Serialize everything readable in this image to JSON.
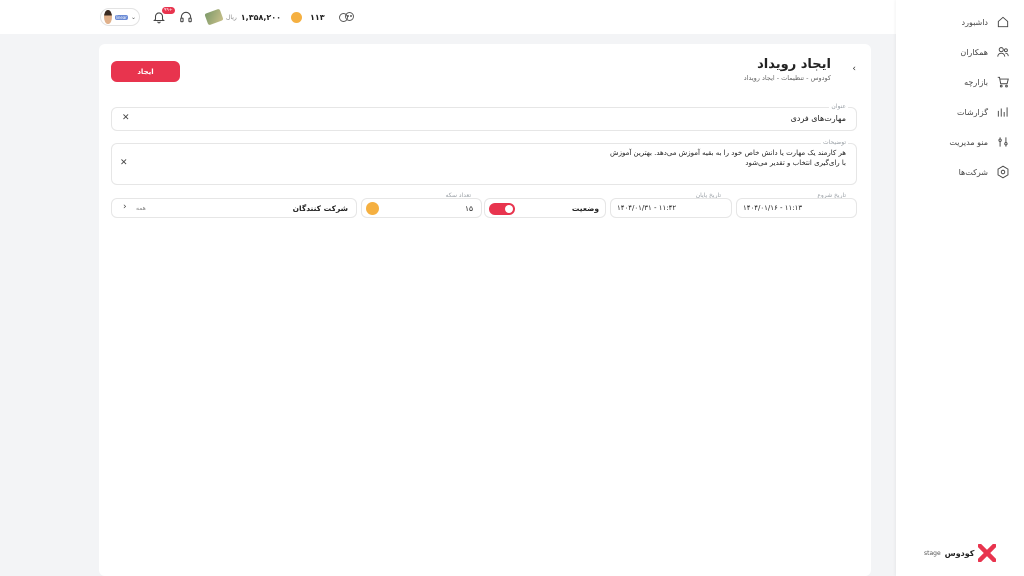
{
  "header": {
    "balance": "۱,۳۵۸,۲۰۰",
    "currency": "ریال",
    "coins": "۱۱۳",
    "notif_count": "۹۹+",
    "avatar_tag": "linear"
  },
  "sidebar": {
    "items": [
      {
        "label": "داشبورد",
        "icon": "home-icon"
      },
      {
        "label": "همکاران",
        "icon": "users-icon"
      },
      {
        "label": "بازارچه",
        "icon": "cart-icon"
      },
      {
        "label": "گزارشات",
        "icon": "chart-icon"
      },
      {
        "label": "منو مدیریت",
        "icon": "sliders-icon"
      },
      {
        "label": "شرکت‌ها",
        "icon": "settings-icon"
      }
    ],
    "brand": "کودوس",
    "brand_tag": "stage"
  },
  "page": {
    "title": "ایجاد رویداد",
    "breadcrumb": "کودوس - تنظیمات - ایجاد رویداد",
    "create_button": "ایجاد"
  },
  "form": {
    "title_label": "عنوان",
    "title_value": "مهارت‌های فردی",
    "desc_label": "توضیحات",
    "desc_line1": "هر کارمند یک مهارت یا دانش خاص خود را به بقیه آموزش می‌دهد. بهترین آموزش",
    "desc_line2": "با رای‌گیری انتخاب و تقدیر می‌شود",
    "start_label": "تاریخ شروع",
    "start_value": "۱۴۰۴/۰۱/۱۶ - ۱۱:۱۳",
    "end_label": "تاریخ پایان",
    "end_value": "۱۴۰۴/۰۱/۳۱ - ۱۱:۴۲",
    "status_label": "وضعیت",
    "status_on": true,
    "coin_label": "تعداد سکه",
    "coin_value": "۱۵",
    "participants_label": "شرکت کنندگان",
    "participants_value": "همه"
  },
  "colors": {
    "accent": "#e8344e",
    "coin": "#f5b041"
  }
}
